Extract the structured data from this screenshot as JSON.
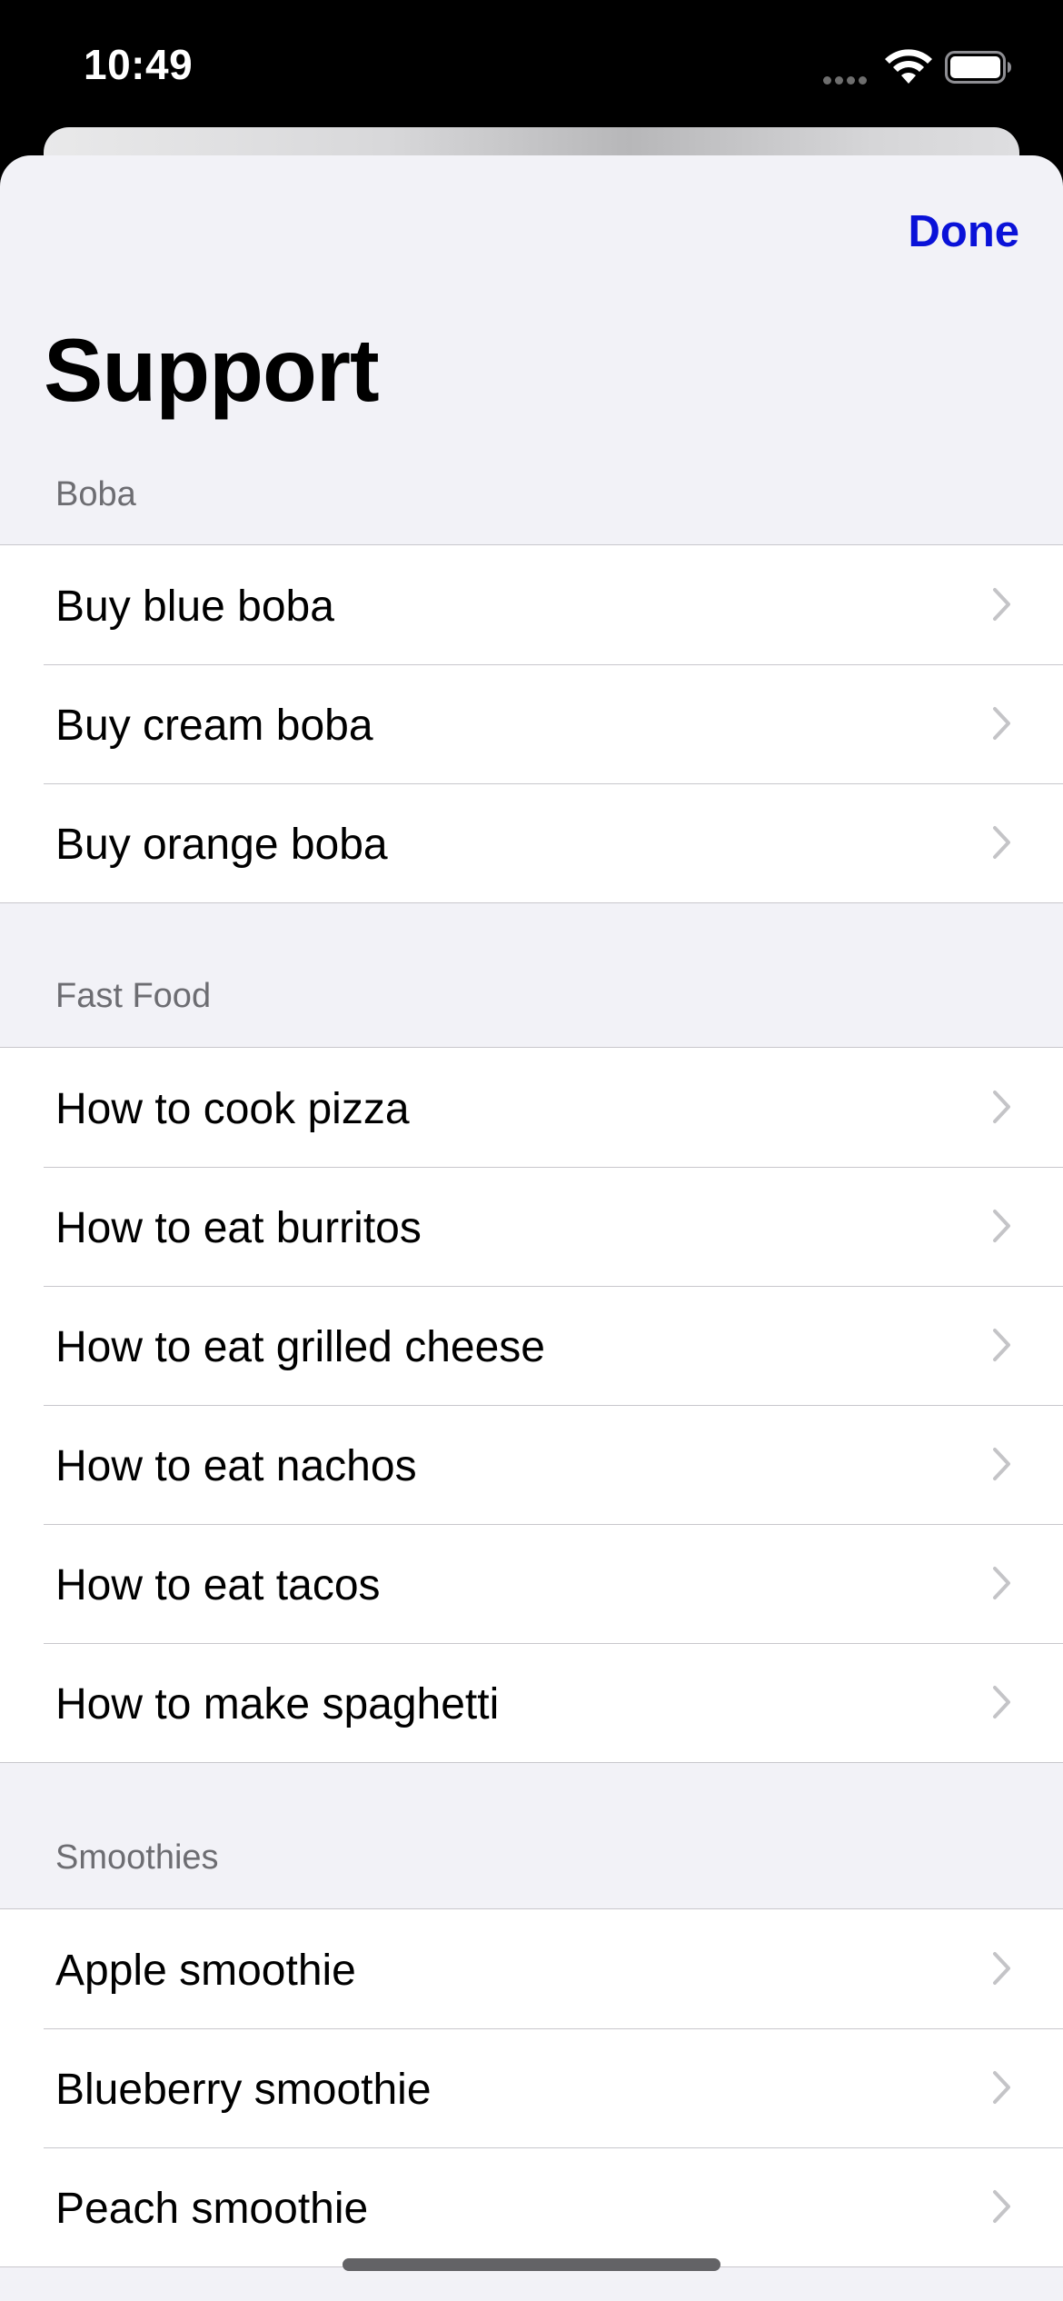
{
  "status_bar": {
    "time": "10:49",
    "signal_icon": "cellular-signal-icon",
    "wifi_icon": "wifi-icon",
    "battery_icon": "battery-icon"
  },
  "nav": {
    "done_label": "Done",
    "title": "Support",
    "accent_color": "#0a12d8"
  },
  "sections": [
    {
      "header": "Boba",
      "items": [
        {
          "label": "Buy blue boba"
        },
        {
          "label": "Buy cream boba"
        },
        {
          "label": "Buy orange boba"
        }
      ]
    },
    {
      "header": "Fast Food",
      "items": [
        {
          "label": "How to cook pizza"
        },
        {
          "label": "How to eat burritos"
        },
        {
          "label": "How to eat grilled cheese"
        },
        {
          "label": "How to eat nachos"
        },
        {
          "label": "How to eat tacos"
        },
        {
          "label": "How to make spaghetti"
        }
      ]
    },
    {
      "header": "Smoothies",
      "items": [
        {
          "label": "Apple smoothie"
        },
        {
          "label": "Blueberry smoothie"
        },
        {
          "label": "Peach smoothie"
        }
      ]
    }
  ],
  "row_accessory_icon": "chevron-right-icon"
}
